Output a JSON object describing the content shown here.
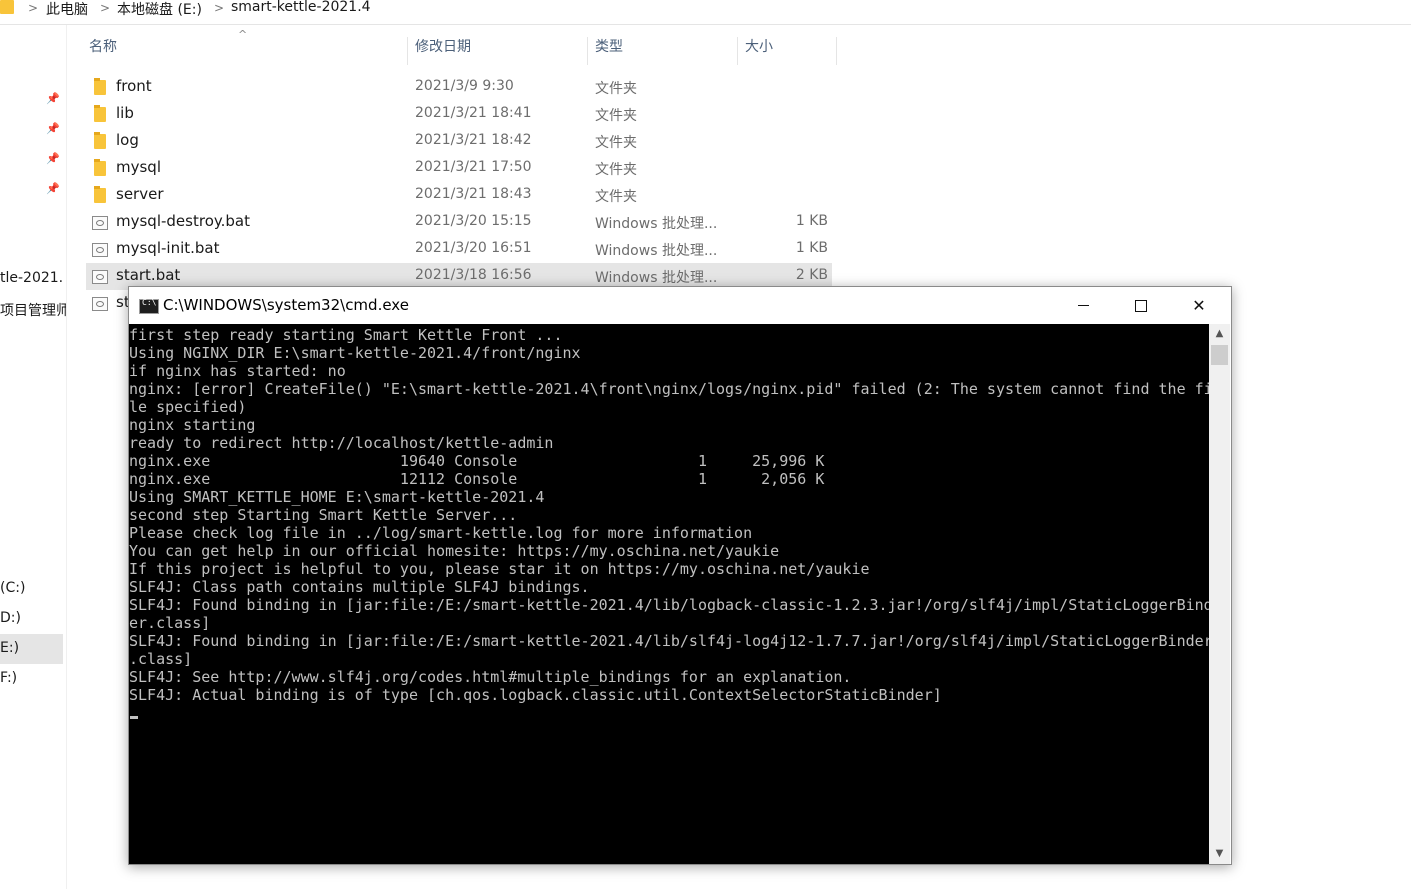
{
  "breadcrumb": {
    "items": [
      "此电脑",
      "本地磁盘 (E:)",
      "smart-kettle-2021.4"
    ]
  },
  "nav": {
    "truncated_items": [
      "tle-2021.",
      "项目管理师"
    ],
    "drives": [
      "(C:)",
      "D:)",
      "E:)",
      "F:)"
    ]
  },
  "columns": {
    "name": "名称",
    "date": "修改日期",
    "type": "类型",
    "size": "大小"
  },
  "files": [
    {
      "name": "front",
      "date": "2021/3/9 9:30",
      "type": "文件夹",
      "size": "",
      "icon": "folder-icon"
    },
    {
      "name": "lib",
      "date": "2021/3/21 18:41",
      "type": "文件夹",
      "size": "",
      "icon": "folder-icon"
    },
    {
      "name": "log",
      "date": "2021/3/21 18:42",
      "type": "文件夹",
      "size": "",
      "icon": "folder-icon"
    },
    {
      "name": "mysql",
      "date": "2021/3/21 17:50",
      "type": "文件夹",
      "size": "",
      "icon": "folder-icon"
    },
    {
      "name": "server",
      "date": "2021/3/21 18:43",
      "type": "文件夹",
      "size": "",
      "icon": "folder-icon"
    },
    {
      "name": "mysql-destroy.bat",
      "date": "2021/3/20 15:15",
      "type": "Windows 批处理...",
      "size": "1 KB",
      "icon": "batch-file-icon"
    },
    {
      "name": "mysql-init.bat",
      "date": "2021/3/20 16:51",
      "type": "Windows 批处理...",
      "size": "1 KB",
      "icon": "batch-file-icon"
    },
    {
      "name": "start.bat",
      "date": "2021/3/18 16:56",
      "type": "Windows 批处理...",
      "size": "2 KB",
      "icon": "batch-file-icon",
      "selected": true
    },
    {
      "name": "st",
      "date": "",
      "type": "",
      "size": "",
      "icon": "batch-file-icon"
    }
  ],
  "cmd": {
    "title": "C:\\WINDOWS\\system32\\cmd.exe",
    "icon_text": "C:\\",
    "output": "first step ready starting Smart Kettle Front ...\nUsing NGINX_DIR E:\\smart-kettle-2021.4/front/nginx\nif nginx has started: no\nnginx: [error] CreateFile() \"E:\\smart-kettle-2021.4\\front\\nginx/logs/nginx.pid\" failed (2: The system cannot find the fi\nle specified)\nnginx starting\nready to redirect http://localhost/kettle-admin\nnginx.exe                     19640 Console                    1     25,996 K\nnginx.exe                     12112 Console                    1      2,056 K\nUsing SMART_KETTLE_HOME E:\\smart-kettle-2021.4\nsecond step Starting Smart Kettle Server...\nPlease check log file in ../log/smart-kettle.log for more information\nYou can get help in our official homesite: https://my.oschina.net/yaukie\nIf this project is helpful to you, please star it on https://my.oschina.net/yaukie\nSLF4J: Class path contains multiple SLF4J bindings.\nSLF4J: Found binding in [jar:file:/E:/smart-kettle-2021.4/lib/logback-classic-1.2.3.jar!/org/slf4j/impl/StaticLoggerBind\ner.class]\nSLF4J: Found binding in [jar:file:/E:/smart-kettle-2021.4/lib/slf4j-log4j12-1.7.7.jar!/org/slf4j/impl/StaticLoggerBinder\n.class]\nSLF4J: See http://www.slf4j.org/codes.html#multiple_bindings for an explanation.\nSLF4J: Actual binding is of type [ch.qos.logback.classic.util.ContextSelectorStaticBinder]"
  }
}
